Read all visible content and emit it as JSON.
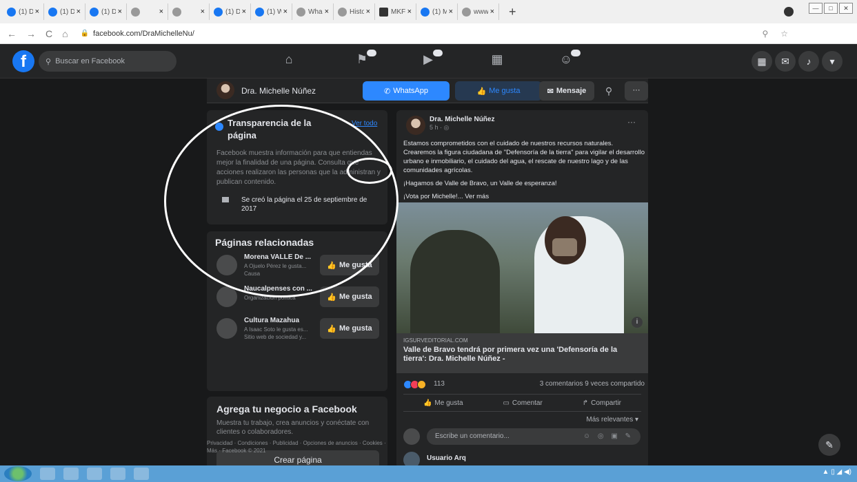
{
  "browser": {
    "tabs": [
      {
        "label": "(1) D",
        "fav": "fb"
      },
      {
        "label": "(1) D",
        "fav": "fb"
      },
      {
        "label": "(1) D",
        "fav": "fb"
      },
      {
        "label": "",
        "fav": "grey"
      },
      {
        "label": "",
        "fav": "grey"
      },
      {
        "label": "(1) D",
        "fav": "fb"
      },
      {
        "label": "(1) W",
        "fav": "fb"
      },
      {
        "label": "Wha",
        "fav": "grey"
      },
      {
        "label": "Histo",
        "fav": "grey"
      },
      {
        "label": "MKF",
        "fav": "dark"
      },
      {
        "label": "(1) M",
        "fav": "fb"
      },
      {
        "label": "www",
        "fav": "grey"
      }
    ],
    "new_tab": "+",
    "close_glyph": "×",
    "url": "facebook.com/DraMichelleNu/"
  },
  "fb": {
    "search_placeholder": "Buscar en Facebook",
    "logo": "f"
  },
  "page_bar": {
    "name": "Dra. Michelle Núñez",
    "whatsapp": "WhatsApp",
    "like": "Me gusta",
    "message": "Mensaje",
    "more": "···"
  },
  "transparency": {
    "title": "Transparencia de la página",
    "see_all": "Ver todo",
    "description": "Facebook muestra información para que entiendas mejor la finalidad de una página. Consulta qué acciones realizaron las personas que la administran y publican contenido.",
    "created": "Se creó la página el 25 de septiembre de 2017"
  },
  "related": {
    "title": "Páginas relacionadas",
    "items": [
      {
        "name": "Morena VALLE De ...",
        "sub": "A Ojuelo Pérez le gusta... Causa"
      },
      {
        "name": "Naucalpenses con ...",
        "sub": "Organización política"
      },
      {
        "name": "Cultura Mazahua",
        "sub": "A Isaac Soto le gusta es... Sitio web de sociedad y..."
      }
    ],
    "like_label": "Me gusta"
  },
  "business": {
    "title": "Agrega tu negocio a Facebook",
    "desc": "Muestra tu trabajo, crea anuncios y conéctate con clientes o colaboradores.",
    "button": "Crear página"
  },
  "footer": "Privacidad · Condiciones · Publicidad · Opciones de anuncios · Cookies · Más · Facebook © 2021",
  "post": {
    "author": "Dra. Michelle Núñez",
    "time": "5 h · ",
    "text1": "Estamos comprometidos con el cuidado de nuestros recursos naturales. Crearemos la figura ciudadana de \"Defensoría de la tierra\" para vigilar el desarrollo urbano e inmobiliario, el cuidado del agua, el rescate de nuestro lago y de las comunidades agrícolas.",
    "text2": "¡Hagamos de Valle de Bravo, un Valle de esperanza!",
    "text3": "¡Vota por Michelle!... Ver más",
    "link_domain": "IGSURVEDITORIAL.COM",
    "link_title": "Valle de Bravo tendrá por primera vez una 'Defensoría de la tierra': Dra. Michelle Núñez -",
    "reactions_count": "113",
    "comments_shares": "3 comentarios  9 veces compartido",
    "like": "Me gusta",
    "comment": "Comentar",
    "share": "Compartir",
    "relevant": "Más relevantes ▾",
    "comment_placeholder": "Escribe un comentario...",
    "next_commenter": "Usuario Arq"
  },
  "colors": {
    "fb_blue": "#1877f2",
    "bg": "#18191a",
    "card": "#242526"
  }
}
